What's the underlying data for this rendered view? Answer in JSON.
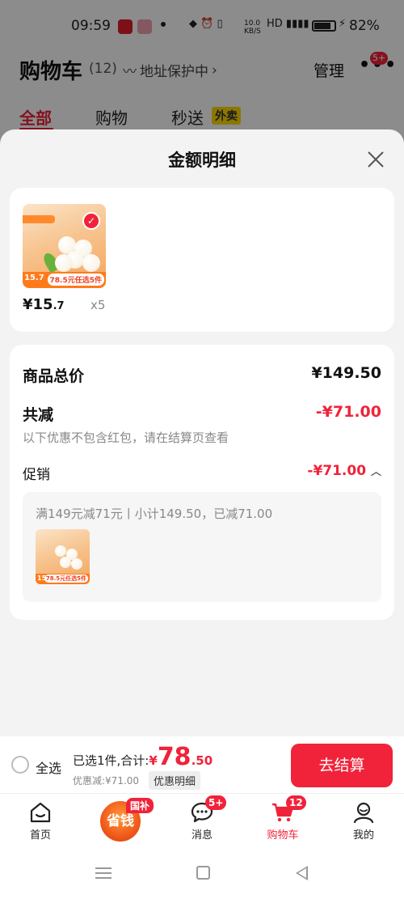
{
  "status_bar": {
    "time": "09:59",
    "network_speed": "10.0 KB/S",
    "battery_percent": "82%"
  },
  "cart": {
    "title": "购物车",
    "count": "(12)",
    "address_protect": "地址保护中",
    "manage_label": "管理",
    "more_badge": "5+",
    "tabs": [
      {
        "label": "全部",
        "active": true
      },
      {
        "label": "购物",
        "active": false
      },
      {
        "label": "秒送",
        "active": false,
        "tag": "外卖"
      }
    ]
  },
  "sheet": {
    "title": "金额明细",
    "product": {
      "price_int": "¥15",
      "price_dec": ".7",
      "quantity": "x5",
      "image_promo": "78.5元任选5件",
      "image_price": "15.7"
    },
    "summary": {
      "total_label": "商品总价",
      "total_value": "¥149.50",
      "reduce_label": "共减",
      "reduce_value": "-¥71.00",
      "reduce_note": "以下优惠不包含红包，请在结算页查看",
      "promo_label": "促销",
      "promo_value": "-¥71.00",
      "promo_desc": "满149元减71元丨小计149.50，已减71.00"
    }
  },
  "checkout": {
    "select_all": "全选",
    "selected_total_prefix": "已选1件,合计:",
    "currency": "¥",
    "total_int": "78",
    "total_dec": ".50",
    "discount_text": "优惠减:¥71.00",
    "detail_chip": "优惠明细",
    "checkout_button": "去结算"
  },
  "tabbar": {
    "items": [
      {
        "label": "首页"
      },
      {
        "label": "省钱",
        "badge": "国补"
      },
      {
        "label": "消息",
        "badge": "5+"
      },
      {
        "label": "购物车",
        "badge": "12",
        "active": true
      },
      {
        "label": "我的"
      }
    ]
  },
  "colors": {
    "accent": "#f0233a",
    "sheet_bg": "#f3f3f3",
    "overlay": "rgba(0,0,0,0.45)"
  }
}
